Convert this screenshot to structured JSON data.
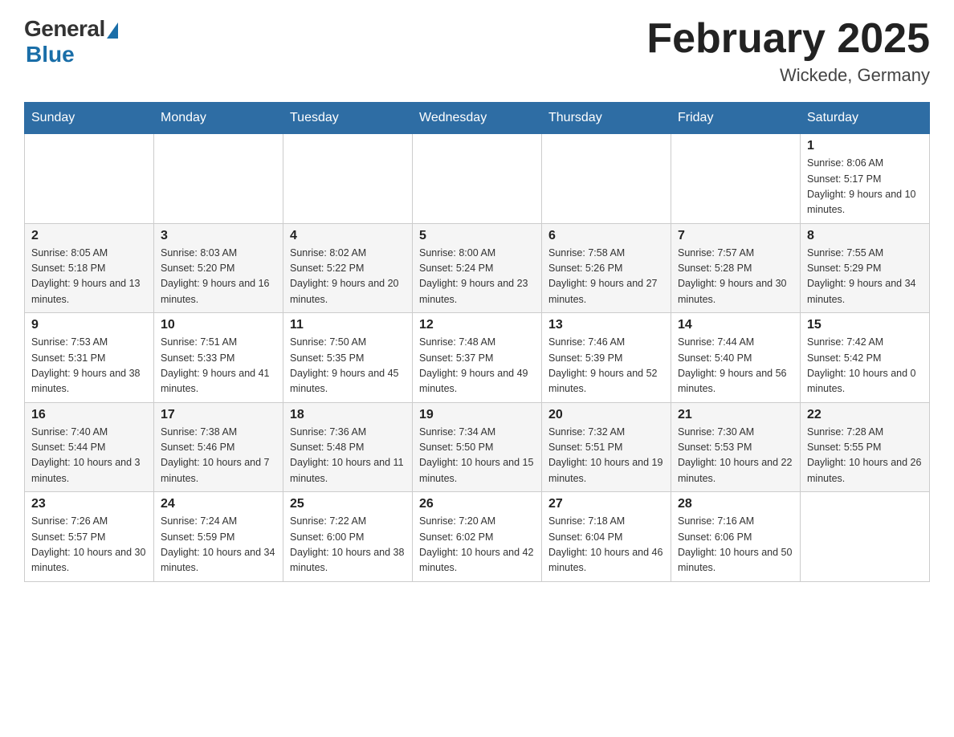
{
  "header": {
    "logo_general": "General",
    "logo_blue": "Blue",
    "title": "February 2025",
    "subtitle": "Wickede, Germany"
  },
  "weekdays": [
    "Sunday",
    "Monday",
    "Tuesday",
    "Wednesday",
    "Thursday",
    "Friday",
    "Saturday"
  ],
  "weeks": [
    [
      {
        "day": "",
        "info": ""
      },
      {
        "day": "",
        "info": ""
      },
      {
        "day": "",
        "info": ""
      },
      {
        "day": "",
        "info": ""
      },
      {
        "day": "",
        "info": ""
      },
      {
        "day": "",
        "info": ""
      },
      {
        "day": "1",
        "info": "Sunrise: 8:06 AM\nSunset: 5:17 PM\nDaylight: 9 hours and 10 minutes."
      }
    ],
    [
      {
        "day": "2",
        "info": "Sunrise: 8:05 AM\nSunset: 5:18 PM\nDaylight: 9 hours and 13 minutes."
      },
      {
        "day": "3",
        "info": "Sunrise: 8:03 AM\nSunset: 5:20 PM\nDaylight: 9 hours and 16 minutes."
      },
      {
        "day": "4",
        "info": "Sunrise: 8:02 AM\nSunset: 5:22 PM\nDaylight: 9 hours and 20 minutes."
      },
      {
        "day": "5",
        "info": "Sunrise: 8:00 AM\nSunset: 5:24 PM\nDaylight: 9 hours and 23 minutes."
      },
      {
        "day": "6",
        "info": "Sunrise: 7:58 AM\nSunset: 5:26 PM\nDaylight: 9 hours and 27 minutes."
      },
      {
        "day": "7",
        "info": "Sunrise: 7:57 AM\nSunset: 5:28 PM\nDaylight: 9 hours and 30 minutes."
      },
      {
        "day": "8",
        "info": "Sunrise: 7:55 AM\nSunset: 5:29 PM\nDaylight: 9 hours and 34 minutes."
      }
    ],
    [
      {
        "day": "9",
        "info": "Sunrise: 7:53 AM\nSunset: 5:31 PM\nDaylight: 9 hours and 38 minutes."
      },
      {
        "day": "10",
        "info": "Sunrise: 7:51 AM\nSunset: 5:33 PM\nDaylight: 9 hours and 41 minutes."
      },
      {
        "day": "11",
        "info": "Sunrise: 7:50 AM\nSunset: 5:35 PM\nDaylight: 9 hours and 45 minutes."
      },
      {
        "day": "12",
        "info": "Sunrise: 7:48 AM\nSunset: 5:37 PM\nDaylight: 9 hours and 49 minutes."
      },
      {
        "day": "13",
        "info": "Sunrise: 7:46 AM\nSunset: 5:39 PM\nDaylight: 9 hours and 52 minutes."
      },
      {
        "day": "14",
        "info": "Sunrise: 7:44 AM\nSunset: 5:40 PM\nDaylight: 9 hours and 56 minutes."
      },
      {
        "day": "15",
        "info": "Sunrise: 7:42 AM\nSunset: 5:42 PM\nDaylight: 10 hours and 0 minutes."
      }
    ],
    [
      {
        "day": "16",
        "info": "Sunrise: 7:40 AM\nSunset: 5:44 PM\nDaylight: 10 hours and 3 minutes."
      },
      {
        "day": "17",
        "info": "Sunrise: 7:38 AM\nSunset: 5:46 PM\nDaylight: 10 hours and 7 minutes."
      },
      {
        "day": "18",
        "info": "Sunrise: 7:36 AM\nSunset: 5:48 PM\nDaylight: 10 hours and 11 minutes."
      },
      {
        "day": "19",
        "info": "Sunrise: 7:34 AM\nSunset: 5:50 PM\nDaylight: 10 hours and 15 minutes."
      },
      {
        "day": "20",
        "info": "Sunrise: 7:32 AM\nSunset: 5:51 PM\nDaylight: 10 hours and 19 minutes."
      },
      {
        "day": "21",
        "info": "Sunrise: 7:30 AM\nSunset: 5:53 PM\nDaylight: 10 hours and 22 minutes."
      },
      {
        "day": "22",
        "info": "Sunrise: 7:28 AM\nSunset: 5:55 PM\nDaylight: 10 hours and 26 minutes."
      }
    ],
    [
      {
        "day": "23",
        "info": "Sunrise: 7:26 AM\nSunset: 5:57 PM\nDaylight: 10 hours and 30 minutes."
      },
      {
        "day": "24",
        "info": "Sunrise: 7:24 AM\nSunset: 5:59 PM\nDaylight: 10 hours and 34 minutes."
      },
      {
        "day": "25",
        "info": "Sunrise: 7:22 AM\nSunset: 6:00 PM\nDaylight: 10 hours and 38 minutes."
      },
      {
        "day": "26",
        "info": "Sunrise: 7:20 AM\nSunset: 6:02 PM\nDaylight: 10 hours and 42 minutes."
      },
      {
        "day": "27",
        "info": "Sunrise: 7:18 AM\nSunset: 6:04 PM\nDaylight: 10 hours and 46 minutes."
      },
      {
        "day": "28",
        "info": "Sunrise: 7:16 AM\nSunset: 6:06 PM\nDaylight: 10 hours and 50 minutes."
      },
      {
        "day": "",
        "info": ""
      }
    ]
  ]
}
